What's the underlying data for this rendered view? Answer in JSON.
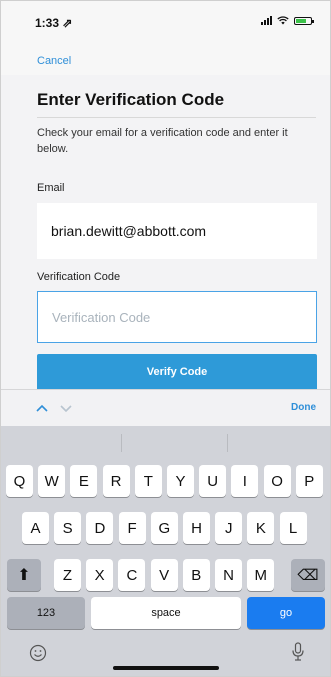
{
  "status_bar": {
    "time": "1:33 ⇗"
  },
  "nav": {
    "cancel_label": "Cancel"
  },
  "form": {
    "title": "Enter Verification Code",
    "instructions": "Check your email for a verification code and enter it below.",
    "email_label": "Email",
    "email_value": "brian.dewitt@abbott.com",
    "code_label": "Verification Code",
    "code_placeholder": "Verification Code",
    "code_value": "",
    "verify_label": "Verify Code"
  },
  "accessory": {
    "done_label": "Done"
  },
  "keyboard": {
    "row1": [
      "Q",
      "W",
      "E",
      "R",
      "T",
      "Y",
      "U",
      "I",
      "O",
      "P"
    ],
    "row2": [
      "A",
      "S",
      "D",
      "F",
      "G",
      "H",
      "J",
      "K",
      "L"
    ],
    "row3": [
      "Z",
      "X",
      "C",
      "V",
      "B",
      "N",
      "M"
    ],
    "numbers_label": "123",
    "space_label": "space",
    "go_label": "go",
    "shift_glyph": "⬆",
    "delete_glyph": "⌫"
  },
  "colors": {
    "accent": "#2e9ad8",
    "go_key": "#1a7cf0",
    "input_border": "#4aa3e6"
  },
  "icons": {
    "up": "chevron-up-icon",
    "down": "chevron-down-icon",
    "emoji": "emoji-icon",
    "mic": "microphone-icon"
  }
}
